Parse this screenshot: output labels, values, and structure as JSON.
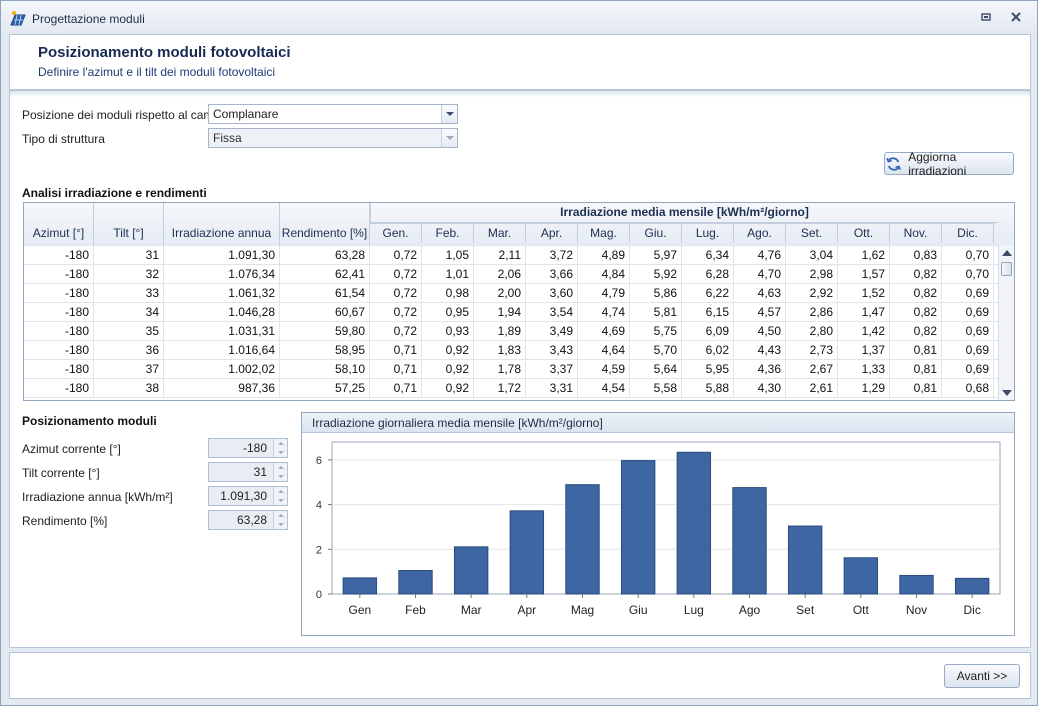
{
  "window": {
    "title": "Progettazione moduli"
  },
  "header": {
    "title": "Posizionamento moduli fotovoltaici",
    "subtitle": "Definire l'azimut e il tilt dei moduli fotovoltaici"
  },
  "form": {
    "posizione_label": "Posizione dei moduli rispetto al campo",
    "posizione_value": "Complanare",
    "struttura_label": "Tipo di struttura",
    "struttura_value": "Fissa",
    "refresh_button": "Aggiorna irradiazioni"
  },
  "analisi": {
    "title": "Analisi irradiazione e rendimenti",
    "group_header": "Irradiazione media mensile [kWh/m²/giorno]",
    "columns": [
      "Azimut [°]",
      "Tilt [°]",
      "Irradiazione annua",
      "Rendimento [%]",
      "Gen.",
      "Feb.",
      "Mar.",
      "Apr.",
      "Mag.",
      "Giu.",
      "Lug.",
      "Ago.",
      "Set.",
      "Ott.",
      "Nov.",
      "Dic."
    ],
    "rows": [
      [
        "-180",
        "31",
        "1.091,30",
        "63,28",
        "0,72",
        "1,05",
        "2,11",
        "3,72",
        "4,89",
        "5,97",
        "6,34",
        "4,76",
        "3,04",
        "1,62",
        "0,83",
        "0,70"
      ],
      [
        "-180",
        "32",
        "1.076,34",
        "62,41",
        "0,72",
        "1,01",
        "2,06",
        "3,66",
        "4,84",
        "5,92",
        "6,28",
        "4,70",
        "2,98",
        "1,57",
        "0,82",
        "0,70"
      ],
      [
        "-180",
        "33",
        "1.061,32",
        "61,54",
        "0,72",
        "0,98",
        "2,00",
        "3,60",
        "4,79",
        "5,86",
        "6,22",
        "4,63",
        "2,92",
        "1,52",
        "0,82",
        "0,69"
      ],
      [
        "-180",
        "34",
        "1.046,28",
        "60,67",
        "0,72",
        "0,95",
        "1,94",
        "3,54",
        "4,74",
        "5,81",
        "6,15",
        "4,57",
        "2,86",
        "1,47",
        "0,82",
        "0,69"
      ],
      [
        "-180",
        "35",
        "1.031,31",
        "59,80",
        "0,72",
        "0,93",
        "1,89",
        "3,49",
        "4,69",
        "5,75",
        "6,09",
        "4,50",
        "2,80",
        "1,42",
        "0,82",
        "0,69"
      ],
      [
        "-180",
        "36",
        "1.016,64",
        "58,95",
        "0,71",
        "0,92",
        "1,83",
        "3,43",
        "4,64",
        "5,70",
        "6,02",
        "4,43",
        "2,73",
        "1,37",
        "0,81",
        "0,69"
      ],
      [
        "-180",
        "37",
        "1.002,02",
        "58,10",
        "0,71",
        "0,92",
        "1,78",
        "3,37",
        "4,59",
        "5,64",
        "5,95",
        "4,36",
        "2,67",
        "1,33",
        "0,81",
        "0,69"
      ],
      [
        "-180",
        "38",
        "987,36",
        "57,25",
        "0,71",
        "0,92",
        "1,72",
        "3,31",
        "4,54",
        "5,58",
        "5,88",
        "4,30",
        "2,61",
        "1,29",
        "0,81",
        "0,68"
      ]
    ]
  },
  "posizionamento": {
    "title": "Posizionamento moduli",
    "azimut_label": "Azimut corrente [°]",
    "azimut_value": "-180",
    "tilt_label": "Tilt corrente [°]",
    "tilt_value": "31",
    "irradiazione_label": "Irradiazione annua [kWh/m²]",
    "irradiazione_value": "1.091,30",
    "rendimento_label": "Rendimento [%]",
    "rendimento_value": "63,28"
  },
  "chart_panel": {
    "caption": "Irradiazione giornaliera media mensile [kWh/m²/giorno]"
  },
  "chart_data": {
    "type": "bar",
    "title": "Irradiazione giornaliera media mensile [kWh/m²/giorno]",
    "categories": [
      "Gen",
      "Feb",
      "Mar",
      "Apr",
      "Mag",
      "Giu",
      "Lug",
      "Ago",
      "Set",
      "Ott",
      "Nov",
      "Dic"
    ],
    "values": [
      0.72,
      1.05,
      2.11,
      3.72,
      4.89,
      5.97,
      6.34,
      4.76,
      3.04,
      1.62,
      0.83,
      0.7
    ],
    "yticks": [
      "0",
      "2",
      "4",
      "6"
    ],
    "ylim": [
      0,
      6.8
    ],
    "grid": true,
    "bar_color": "#3e66a2"
  },
  "footer": {
    "next_button": "Avanti >>"
  }
}
